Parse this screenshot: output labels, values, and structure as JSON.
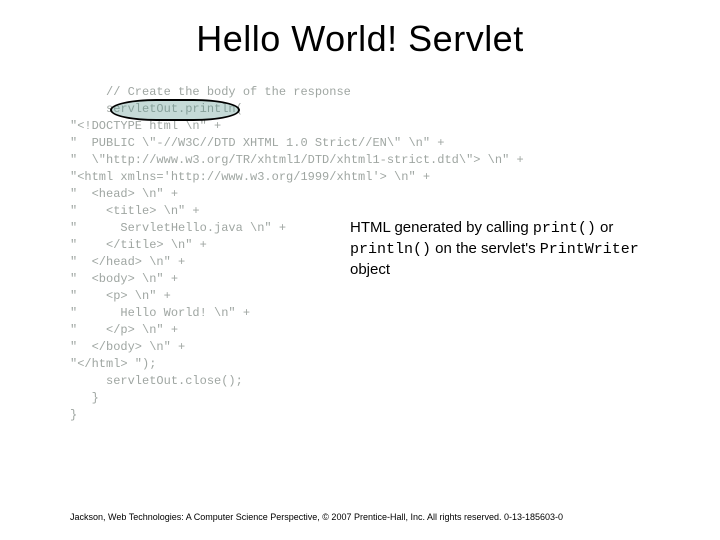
{
  "title": "Hello World! Servlet",
  "code": {
    "l01": "     // Create the body of the response",
    "l02": "     servletOut.println(",
    "l03": "\"<!DOCTYPE html \\n\" +",
    "l04": "\"  PUBLIC \\\"-//W3C//DTD XHTML 1.0 Strict//EN\\\" \\n\" +",
    "l05": "\"  \\\"http://www.w3.org/TR/xhtml1/DTD/xhtml1-strict.dtd\\\"> \\n\" +",
    "l06": "\"<html xmlns='http://www.w3.org/1999/xhtml'> \\n\" +",
    "l07": "\"  <head> \\n\" +",
    "l08": "\"    <title> \\n\" +",
    "l09": "\"      ServletHello.java \\n\" +",
    "l10": "\"    </title> \\n\" +",
    "l11": "\"  </head> \\n\" +",
    "l12": "\"  <body> \\n\" +",
    "l13": "\"    <p> \\n\" +",
    "l14": "\"      Hello World! \\n\" +",
    "l15": "\"    </p> \\n\" +",
    "l16": "\"  </body> \\n\" +",
    "l17": "\"</html> \");",
    "l18": "     servletOut.close();",
    "l19": "   }",
    "l20": "}"
  },
  "callout": {
    "t1": "HTML generated by calling ",
    "c1": "print()",
    "t2": " or ",
    "c2": "println()",
    "t3": " on the servlet's ",
    "c3": "PrintWriter",
    "t4": " object"
  },
  "footer": "Jackson, Web Technologies: A Computer Science Perspective, © 2007 Prentice-Hall, Inc. All rights reserved. 0-13-185603-0"
}
